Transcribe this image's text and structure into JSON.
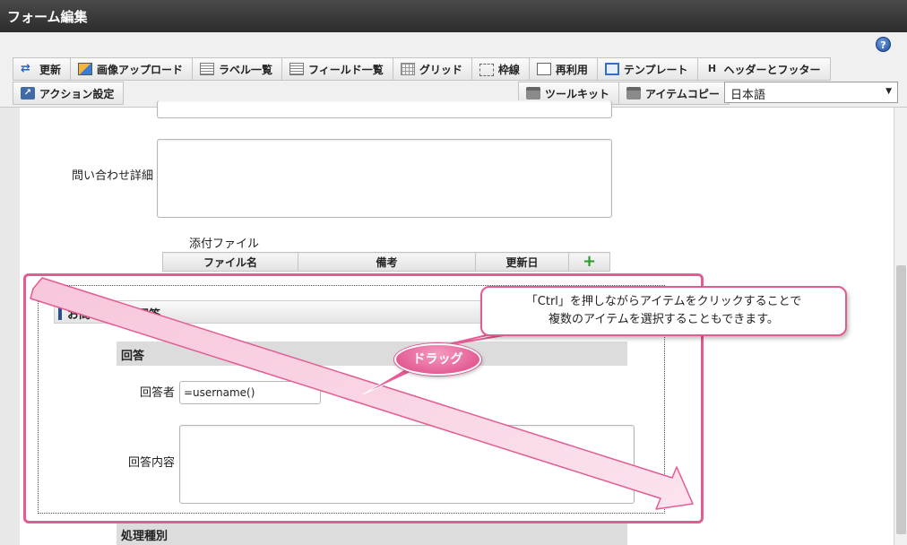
{
  "window": {
    "title": "フォーム編集"
  },
  "toolbar": {
    "row1": [
      {
        "label": "更新",
        "icon": "refresh-icon"
      },
      {
        "label": "画像アップロード",
        "icon": "image-upload-icon"
      },
      {
        "label": "ラベル一覧",
        "icon": "label-list-icon"
      },
      {
        "label": "フィールド一覧",
        "icon": "field-list-icon"
      },
      {
        "label": "グリッド",
        "icon": "grid-icon"
      },
      {
        "label": "枠線",
        "icon": "border-icon"
      },
      {
        "label": "再利用",
        "icon": "reuse-icon"
      },
      {
        "label": "テンプレート",
        "icon": "template-icon"
      },
      {
        "label": "ヘッダーとフッター",
        "icon": "header-footer-icon"
      }
    ],
    "row2": [
      {
        "label": "アクション設定",
        "icon": "action-icon"
      }
    ],
    "tools": [
      {
        "label": "ツールキット",
        "icon": "toolkit-icon"
      },
      {
        "label": "アイテムコピー",
        "icon": "item-copy-icon"
      }
    ],
    "language": {
      "selected": "日本語"
    },
    "help": "?"
  },
  "form": {
    "inquiry_detail_label": "問い合わせ詳細",
    "attachment_label": "添付ファイル",
    "attachment_columns": [
      "ファイル名",
      "備考",
      "更新日"
    ],
    "section_title": "お問い合わせ回答",
    "answer_subsection": "回答",
    "answerer_label": "回答者",
    "answerer_value": "=username()",
    "answer_content_label": "回答内容",
    "processing_subsection": "処理種別"
  },
  "annotation": {
    "callout_line1": "「Ctrl」を押しながらアイテムをクリックすることで",
    "callout_line2": "複数のアイテムを選択することもできます。",
    "drag_label": "ドラッグ",
    "accent_color": "#e35b93"
  }
}
